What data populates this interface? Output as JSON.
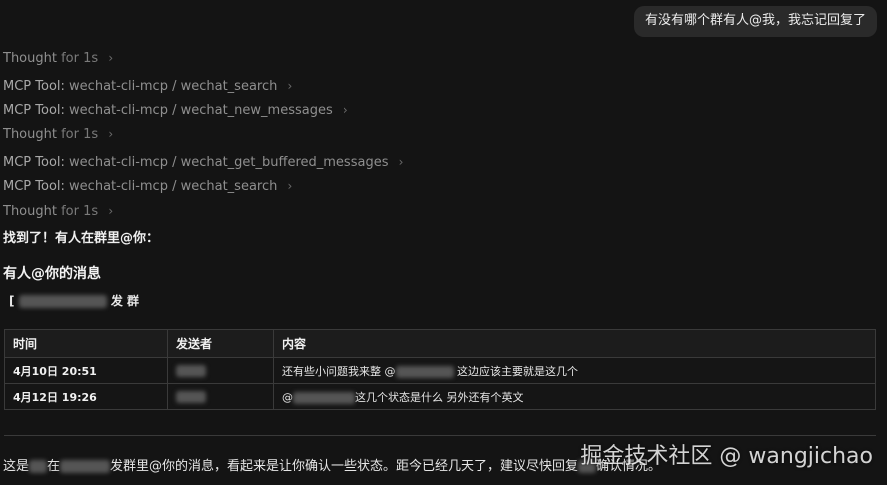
{
  "user_message": "有没有哪个群有人@我，我忘记回复了",
  "steps": [
    {
      "type": "thought",
      "label": "Thought",
      "duration": "for 1s"
    },
    {
      "type": "mcp",
      "prefix": "MCP Tool:",
      "tool": "wechat-cli-mcp / wechat_search"
    },
    {
      "type": "mcp",
      "prefix": "MCP Tool:",
      "tool": "wechat-cli-mcp / wechat_new_messages"
    },
    {
      "type": "thought",
      "label": "Thought",
      "duration": "for 1s"
    },
    {
      "type": "mcp",
      "prefix": "MCP Tool:",
      "tool": "wechat-cli-mcp / wechat_get_buffered_messages"
    },
    {
      "type": "mcp",
      "prefix": "MCP Tool:",
      "tool": "wechat-cli-mcp / wechat_search"
    },
    {
      "type": "thought",
      "label": "Thought",
      "duration": "for 1s"
    }
  ],
  "answer": {
    "found_text": "找到了！有人在群里@你：",
    "heading": "有人@你的消息",
    "group_prefix": "[",
    "group_suffix": "发 群",
    "table": {
      "headers": [
        "时间",
        "发送者",
        "内容"
      ],
      "rows": [
        {
          "time": "4月10日 20:51",
          "content_prefix": "还有些小问题我来整 @",
          "content_suffix": "这边应该主要就是这几个"
        },
        {
          "time": "4月12日 19:26",
          "content_prefix": "@",
          "content_suffix": "这几个状态是什么 另外还有个英文"
        }
      ]
    },
    "bottom_prefix": "这是",
    "bottom_mid1": "在",
    "bottom_mid2": "发群里@你的消息，看起来是让你确认一些状态。距今已经几天了，建议尽快回复",
    "bottom_suffix": "确认情况。"
  },
  "watermark": "掘金技术社区 @ wangjichao"
}
